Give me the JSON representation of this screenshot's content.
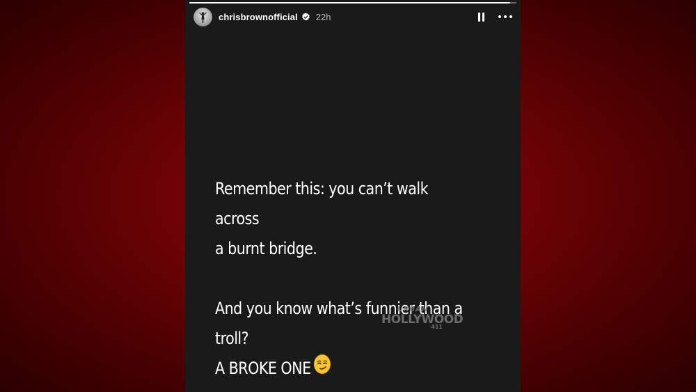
{
  "story": {
    "username": "chrisbrownofficial",
    "verified": true,
    "time": "22h",
    "progress": 0.98,
    "text": {
      "line1": "Remember this: you can’t walk across",
      "line2": "a burnt bridge.",
      "line3": "And you know what’s funnier than a",
      "line4": "troll?",
      "line5": "A BROKE ONE"
    },
    "emoji": "smirking-face-emoji",
    "watermark": {
      "top": "URBAN",
      "main": "HOLLYWOOD",
      "number": "411"
    }
  },
  "icons": {
    "verified": "verified-badge-icon",
    "pause": "pause-icon",
    "more": "more-options-icon"
  },
  "colors": {
    "background_red": "#8e0406",
    "card": "#1a1a1a",
    "verified_badge": "#ffffff",
    "emoji": "#f7c530"
  }
}
